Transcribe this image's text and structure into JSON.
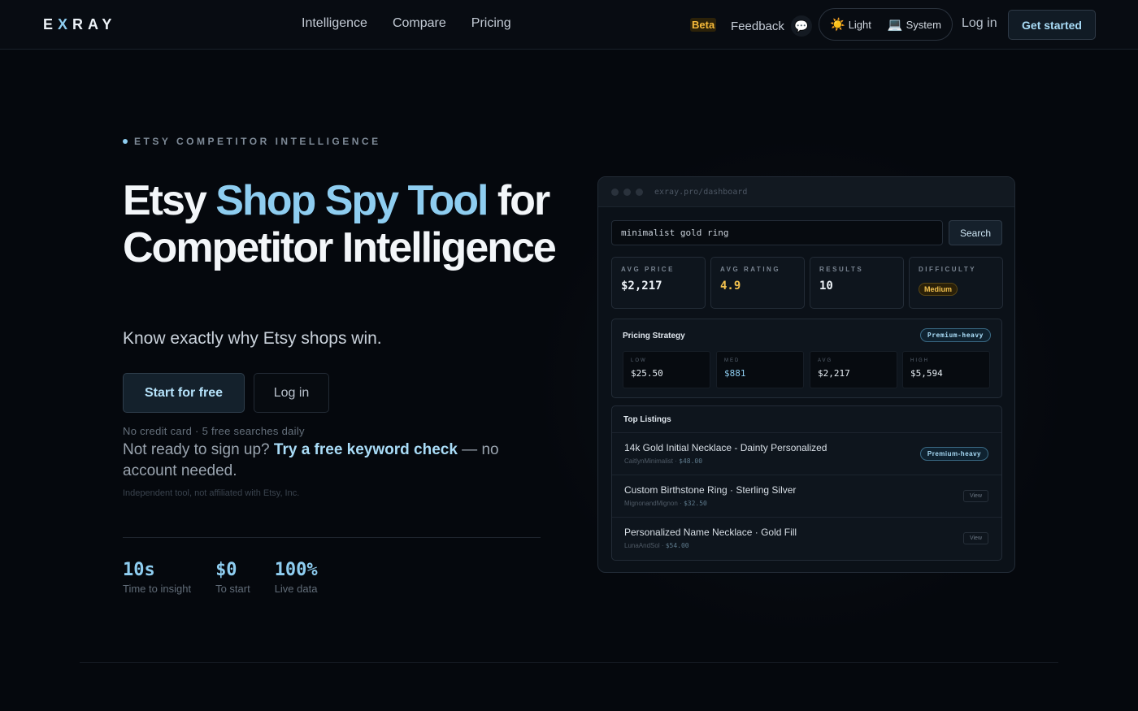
{
  "nav": {
    "logo_pre": "E",
    "logo_accent": "X",
    "logo_post": "RAY",
    "links": [
      "Intelligence",
      "Compare",
      "Pricing"
    ],
    "beta": "Beta",
    "feedback": "Feedback",
    "feedback_icon": "speech-bubble-icon",
    "theme": {
      "light": "Light",
      "light_icon": "sun-icon",
      "system": "System",
      "system_icon": "laptop-icon"
    },
    "login": "Log in",
    "get_started": "Get started"
  },
  "hero": {
    "eyebrow": "ETSY COMPETITOR INTELLIGENCE",
    "title_pre": "Etsy ",
    "title_highlight": "Shop Spy Tool",
    "title_post": " for Competitor Intelligence",
    "subtitle": "Know exactly why Etsy shops win.",
    "cta_primary": "Start for free",
    "cta_secondary": "Log in",
    "note": "No credit card · 5 free searches daily",
    "not_ready_pre": "Not ready to sign up? ",
    "not_ready_link": "Try a free keyword check",
    "not_ready_post": " — no account needed.",
    "disclaimer": "Independent tool, not affiliated with Etsy, Inc.",
    "stats": [
      {
        "value": "10s",
        "label": "Time to insight"
      },
      {
        "value": "$0",
        "label": "To start"
      },
      {
        "value": "100%",
        "label": "Live data"
      }
    ]
  },
  "dashboard": {
    "url": "exray.pro/dashboard",
    "search_value": "minimalist gold ring",
    "search_button": "Search",
    "kpis": [
      {
        "label": "AVG PRICE",
        "value": "$2,217"
      },
      {
        "label": "AVG RATING",
        "value": "4.9"
      },
      {
        "label": "RESULTS",
        "value": "10"
      },
      {
        "label": "DIFFICULTY",
        "value": "Medium"
      }
    ],
    "pricing": {
      "title": "Pricing Strategy",
      "badge": "Premium-heavy",
      "cells": [
        {
          "label": "LOW",
          "value": "$25.50"
        },
        {
          "label": "MED",
          "value": "$881"
        },
        {
          "label": "AVG",
          "value": "$2,217"
        },
        {
          "label": "HIGH",
          "value": "$5,594"
        }
      ]
    },
    "listings": {
      "title": "Top Listings",
      "items": [
        {
          "title": "14k Gold Initial Necklace - Dainty Personalized",
          "shop": "CaitlynMinimalist",
          "price": "$48.00",
          "action": "Premium-heavy"
        },
        {
          "title": "Custom Birthstone Ring · Sterling Silver",
          "shop": "MignonandMignon",
          "price": "$32.50",
          "action": "View"
        },
        {
          "title": "Personalized Name Necklace · Gold Fill",
          "shop": "LunaAndSol",
          "price": "$54.00",
          "action": "View"
        }
      ]
    }
  },
  "colors": {
    "background": "#05080d",
    "accent": "#8ecdf0",
    "gold": "#f2c14e"
  }
}
